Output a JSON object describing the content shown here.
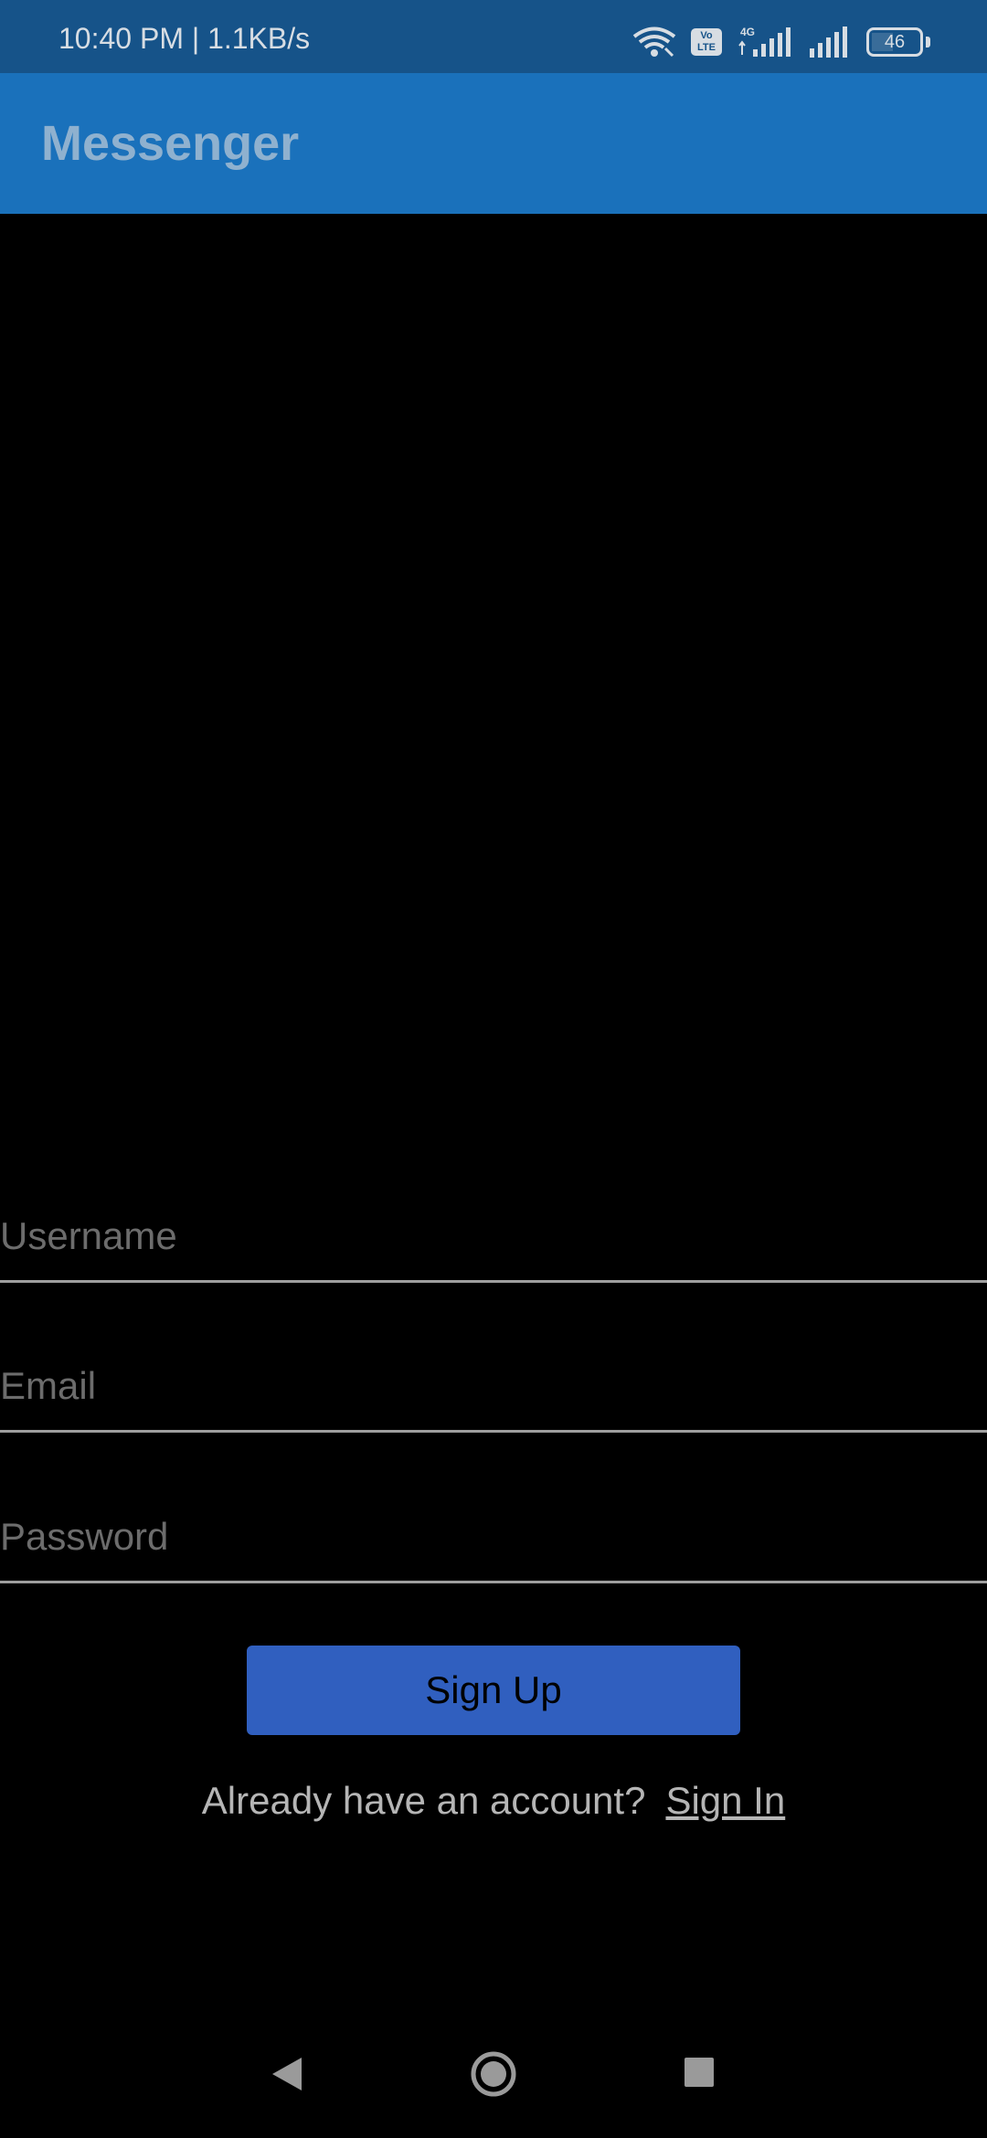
{
  "status_bar": {
    "time": "10:40 PM | 1.1KB/s",
    "network_type": "4G",
    "volte": "Vo LTE",
    "battery_level": "46",
    "battery_fraction": 0.46
  },
  "app_bar": {
    "title": "Messenger"
  },
  "form": {
    "username_placeholder": "Username",
    "username_value": "",
    "email_placeholder": "Email",
    "email_value": "",
    "password_placeholder": "Password",
    "password_value": ""
  },
  "actions": {
    "signup_label": "Sign Up",
    "already_have_account": "Already have an account?",
    "signin_label": "Sign In"
  },
  "navigation": {
    "icons": [
      "back-icon",
      "home-icon",
      "recents-icon"
    ]
  },
  "colors": {
    "status_bar": "#165389",
    "app_bar": "#1a71bb",
    "button": "#305fbf",
    "background": "#000000"
  }
}
